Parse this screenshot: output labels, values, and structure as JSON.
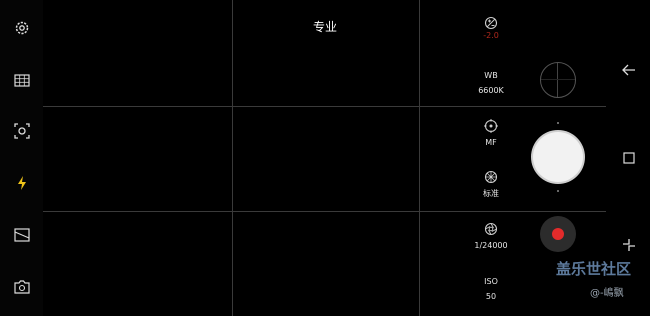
{
  "mode": {
    "title": "专业"
  },
  "left_toolbar": {
    "icons": [
      "gear-icon",
      "grid-icon",
      "focus-icon",
      "flash-icon",
      "aspect-ratio-icon",
      "switch-camera-icon"
    ]
  },
  "pro_controls": {
    "ev": {
      "value": "-2.0"
    },
    "wb": {
      "label": "WB",
      "value": "6600K"
    },
    "focus": {
      "label": "MF"
    },
    "tone": {
      "label": "标准"
    },
    "shutter_speed": {
      "value": "1/24000"
    },
    "iso": {
      "label": "ISO",
      "value": "50"
    }
  },
  "nav": {
    "icons": [
      "back-icon",
      "recents-icon",
      "home-icon"
    ]
  },
  "watermark": {
    "title": "盖乐世社区",
    "credit": "@-嶋飘"
  },
  "colors": {
    "record": "#e32b2b",
    "ev": "#b0281c",
    "watermark": "#5d7a9c"
  }
}
